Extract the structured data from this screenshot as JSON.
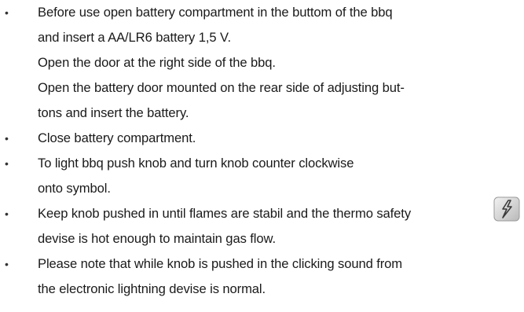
{
  "document": {
    "bullet_char": "•",
    "lines": [
      "Before use open battery compartment in the buttom of the bbq",
      "and insert a AA/LR6 battery 1,5 V.",
      "Open the door at the right side of the bbq.",
      "Open the battery door mounted on the rear side of adjusting but-",
      "tons and insert the battery.",
      "Close battery compartment.",
      "To light bbq push knob and turn knob counter clockwise",
      "onto symbol.",
      "Keep knob pushed in until flames are stabil and the thermo safety",
      "devise is hot enough to maintain gas flow.",
      "Please note that while knob is pushed in the clicking sound from",
      "the electronic lightning devise is normal."
    ]
  },
  "icons": {
    "ignition_symbol": "ignition-spark-symbol-icon"
  }
}
